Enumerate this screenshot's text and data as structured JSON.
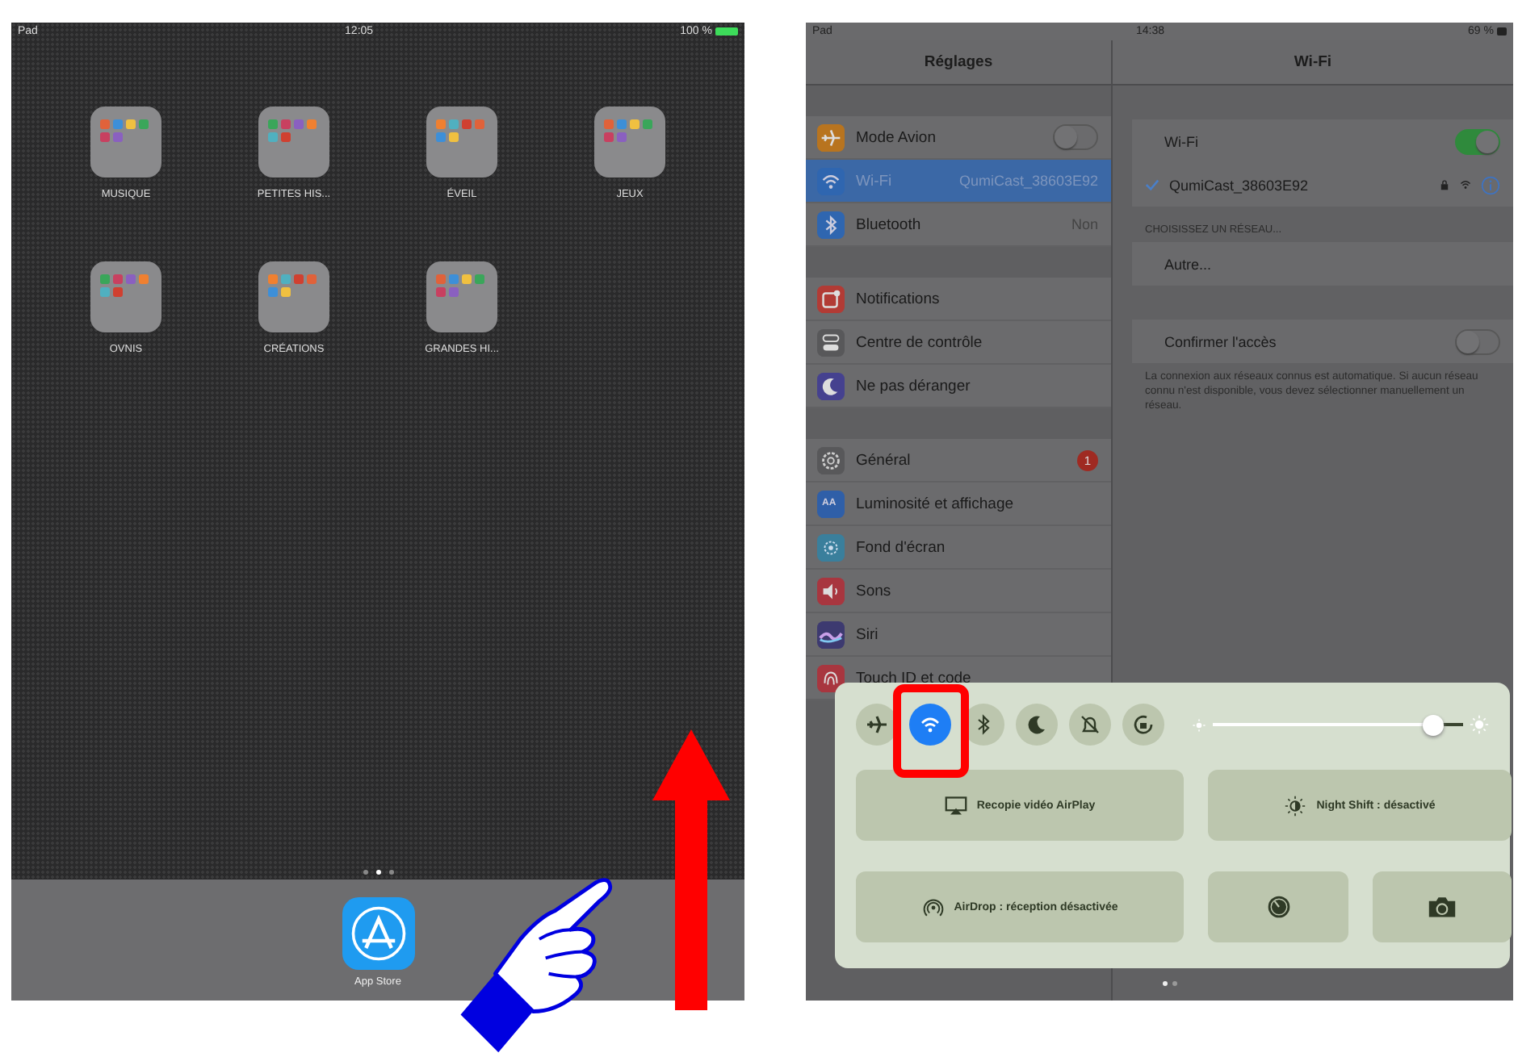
{
  "home_screen": {
    "status_bar": {
      "carrier": "Pad",
      "time": "12:05",
      "battery": "100 %"
    },
    "folders": [
      {
        "label": "MUSIQUE"
      },
      {
        "label": "PETITES HIS..."
      },
      {
        "label": "ÉVEIL"
      },
      {
        "label": "JEUX"
      },
      {
        "label": "OVNIS"
      },
      {
        "label": "CRÉATIONS"
      },
      {
        "label": "GRANDES HI..."
      }
    ],
    "page_dots": [
      {
        "selected": false
      },
      {
        "selected": true
      },
      {
        "selected": false
      }
    ],
    "dock": [
      {
        "label": "App Store"
      }
    ]
  },
  "settings_screen": {
    "status_bar": {
      "carrier": "Pad",
      "time": "14:38",
      "battery": "69 %"
    },
    "sidebar": {
      "title": "Réglages",
      "groups": [
        [
          {
            "kind": "airplane",
            "color": "#b8741f",
            "label": "Mode Avion",
            "toggle": {
              "on": false
            },
            "selected": false
          },
          {
            "kind": "wifi",
            "color": "#2f66b0",
            "label": "Wi-Fi",
            "value": "QumiCast_38603E92",
            "selected": true
          },
          {
            "kind": "bluetooth",
            "color": "#2f66b0",
            "label": "Bluetooth",
            "value": "Non",
            "selected": false
          }
        ],
        [
          {
            "kind": "notifications",
            "color": "#b23b35",
            "label": "Notifications",
            "selected": false
          },
          {
            "kind": "switches",
            "color": "#58585a",
            "label": "Centre de contrôle",
            "selected": false
          },
          {
            "kind": "moon",
            "color": "#45418f",
            "label": "Ne pas déranger",
            "selected": false
          }
        ],
        [
          {
            "kind": "gear",
            "color": "#58585a",
            "label": "Général",
            "badge": "1",
            "selected": false
          },
          {
            "kind": "letters",
            "icon_text": "AA",
            "color": "#2f5fa8",
            "label": "Luminosité et affichage",
            "selected": false
          },
          {
            "kind": "flower",
            "color": "#3a7f9c",
            "label": "Fond d'écran",
            "selected": false
          },
          {
            "kind": "speaker",
            "color": "#a8363f",
            "label": "Sons",
            "selected": false
          },
          {
            "kind": "swirl",
            "color": "#3d3a70",
            "label": "Siri",
            "selected": false
          },
          {
            "kind": "fingerprint",
            "color": "#a8363f",
            "label": "Touch ID et code",
            "selected": false
          }
        ]
      ]
    },
    "detail": {
      "title": "Wi-Fi",
      "wifi_toggle": {
        "label": "Wi-Fi",
        "on": true
      },
      "network": {
        "name": "QumiCast_38603E92",
        "connected": true
      },
      "section_header": "CHOISISSEZ UN RÉSEAU...",
      "other": "Autre...",
      "ask_toggle": {
        "label": "Confirmer l'accès",
        "on": false
      },
      "note": "La connexion aux réseaux connus est automatique. Si aucun réseau connu n'est disponible, vous devez sélectionner manuellement un réseau."
    },
    "control_center": {
      "toggles": [
        {
          "kind": "airplane",
          "on": false
        },
        {
          "kind": "wifi",
          "on": true
        },
        {
          "kind": "bluetooth",
          "on": false
        },
        {
          "kind": "moon",
          "on": false
        },
        {
          "kind": "bell",
          "on": false
        },
        {
          "kind": "rotation-lock",
          "on": false
        }
      ],
      "brightness": {
        "level": 0.88
      },
      "tiles": [
        {
          "kind": "airplay",
          "label": "Recopie vidéo AirPlay"
        },
        {
          "kind": "night-shift",
          "label": "Night Shift : désactivé"
        },
        {
          "kind": "airdrop",
          "label": "AirDrop : réception désactivée"
        },
        {
          "kind": "timer"
        },
        {
          "kind": "camera"
        }
      ]
    },
    "page_dots": [
      {
        "selected": true
      },
      {
        "selected": false
      }
    ]
  }
}
